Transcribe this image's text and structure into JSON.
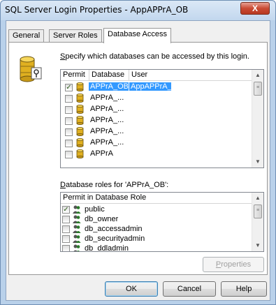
{
  "window": {
    "title": "SQL Server Login Properties - AppAPPrA_OB",
    "close_glyph": "X"
  },
  "tabs": [
    {
      "label": "General",
      "active": false
    },
    {
      "label": "Server Roles",
      "active": false
    },
    {
      "label": "Database Access",
      "active": true
    }
  ],
  "instruction": {
    "accel": "S",
    "rest": "pecify which databases can be accessed by this login."
  },
  "db_list": {
    "headers": {
      "permit": "Permit",
      "database": "Database",
      "user": "User"
    },
    "rows": [
      {
        "checked": true,
        "database": "APPrA_OB",
        "user": "AppAPPrA_OB",
        "selected": true
      },
      {
        "checked": false,
        "database": "APPrA_...",
        "user": "",
        "selected": false
      },
      {
        "checked": false,
        "database": "APPrA_...",
        "user": "",
        "selected": false
      },
      {
        "checked": false,
        "database": "APPrA_...",
        "user": "",
        "selected": false
      },
      {
        "checked": false,
        "database": "APPrA_...",
        "user": "",
        "selected": false
      },
      {
        "checked": false,
        "database": "APPrA_...",
        "user": "",
        "selected": false
      },
      {
        "checked": false,
        "database": "APPrA",
        "user": "",
        "selected": false
      }
    ]
  },
  "roles_label": {
    "accel": "D",
    "rest": "atabase roles for 'APPrA_OB':"
  },
  "roles_list": {
    "header": "Permit in Database Role",
    "rows": [
      {
        "checked": true,
        "role": "public"
      },
      {
        "checked": false,
        "role": "db_owner"
      },
      {
        "checked": false,
        "role": "db_accessadmin"
      },
      {
        "checked": false,
        "role": "db_securityadmin"
      },
      {
        "checked": false,
        "role": "db_ddladmin"
      }
    ]
  },
  "buttons": {
    "properties": {
      "accel": "P",
      "rest": "roperties"
    },
    "ok": "OK",
    "cancel": "Cancel",
    "help": "Help"
  },
  "icons": {
    "database": "database-cylinder-icon",
    "role_user": "user-group-icon",
    "login_key": "database-key-icon"
  },
  "colors": {
    "selection": "#3399ff",
    "window_frame": "#b9d1ea",
    "db_icon": "#e0b020"
  }
}
